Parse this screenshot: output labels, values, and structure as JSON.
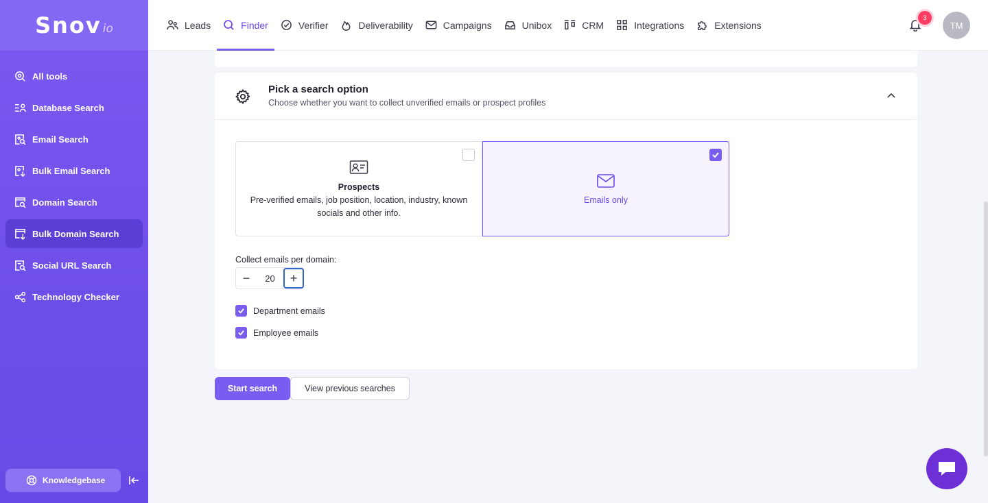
{
  "logo": {
    "main": "Snov",
    "sub": "io"
  },
  "sidebar": {
    "items": [
      {
        "label": "All tools",
        "icon": "tools-search-icon"
      },
      {
        "label": "Database Search",
        "icon": "database-list-icon"
      },
      {
        "label": "Email Search",
        "icon": "email-search-icon"
      },
      {
        "label": "Bulk Email Search",
        "icon": "bulk-email-icon"
      },
      {
        "label": "Domain Search",
        "icon": "domain-search-icon"
      },
      {
        "label": "Bulk Domain Search",
        "icon": "bulk-domain-icon",
        "active": true
      },
      {
        "label": "Social URL Search",
        "icon": "social-url-icon"
      },
      {
        "label": "Technology Checker",
        "icon": "technology-icon"
      }
    ],
    "knowledgebase": "Knowledgebase"
  },
  "topnav": {
    "items": [
      {
        "label": "Leads",
        "icon": "users-icon"
      },
      {
        "label": "Finder",
        "icon": "search-icon",
        "active": true
      },
      {
        "label": "Verifier",
        "icon": "check-circle-icon"
      },
      {
        "label": "Deliverability",
        "icon": "flame-icon"
      },
      {
        "label": "Campaigns",
        "icon": "envelope-icon"
      },
      {
        "label": "Unibox",
        "icon": "inbox-icon"
      },
      {
        "label": "CRM",
        "icon": "crm-icon"
      },
      {
        "label": "Integrations",
        "icon": "grid-icon"
      },
      {
        "label": "Extensions",
        "icon": "puzzle-icon"
      }
    ],
    "notifications": "3",
    "avatar": "TM"
  },
  "search_option": {
    "title": "Pick a search option",
    "subtitle": "Choose whether you want to collect unverified emails or prospect profiles",
    "prospects": {
      "title": "Prospects",
      "description": "Pre-verified emails, job position, location, industry, known socials and other info.",
      "selected": false
    },
    "emails_only": {
      "title": "Emails only",
      "selected": true
    },
    "collect_label": "Collect emails per domain:",
    "emails_per_domain": "20",
    "department_emails": "Department emails",
    "employee_emails": "Employee emails"
  },
  "actions": {
    "start": "Start search",
    "previous": "View previous searches"
  },
  "colors": {
    "accent": "#7b5cf0",
    "sidebar": "#7357ee",
    "badge": "#ff3d63",
    "chat": "#6d2fd6"
  }
}
